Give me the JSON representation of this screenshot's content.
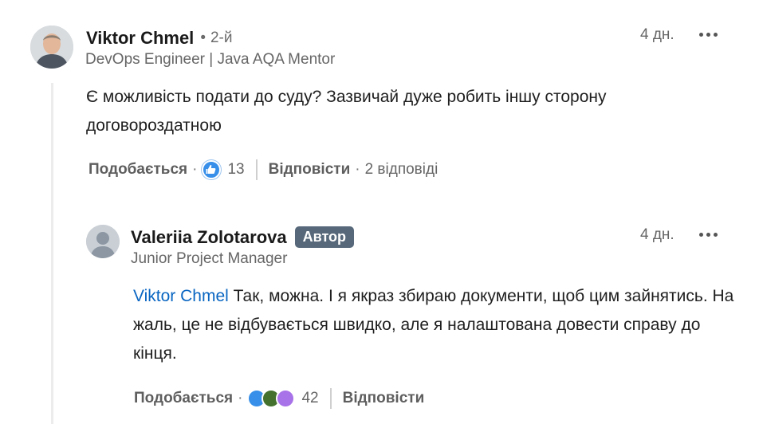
{
  "comment": {
    "author": "Viktor Chmel",
    "degree_dot": "•",
    "degree": "2-й",
    "headline": "DevOps Engineer | Java AQA Mentor",
    "time": "4 дн.",
    "text": "Є можливість подати до суду? Зазвичай дуже робить іншу сторону договороздатною",
    "like_label": "Подобається",
    "reaction_count": "13",
    "reply_label": "Відповісти",
    "replies_count": "2 відповіді",
    "sep": "·"
  },
  "reply": {
    "author": "Valeriia Zolotarova",
    "badge": "Автор",
    "headline": "Junior Project Manager",
    "time": "4 дн.",
    "mention": "Viktor Chmel",
    "text": " Так, можна. І я якраз збираю документи, щоб цим зайнятись. На жаль, це не відбувається швидко, але я налаштована довести справу до кінця.",
    "like_label": "Подобається",
    "reaction_count": "42",
    "reply_label": "Відповісти",
    "sep": "·"
  },
  "colors": {
    "mention": "#0a66c2",
    "badge_bg": "#56687a",
    "like_blue": "#378fe9",
    "celebrate_green": "#44712e",
    "support_purple": "#a872e8"
  }
}
